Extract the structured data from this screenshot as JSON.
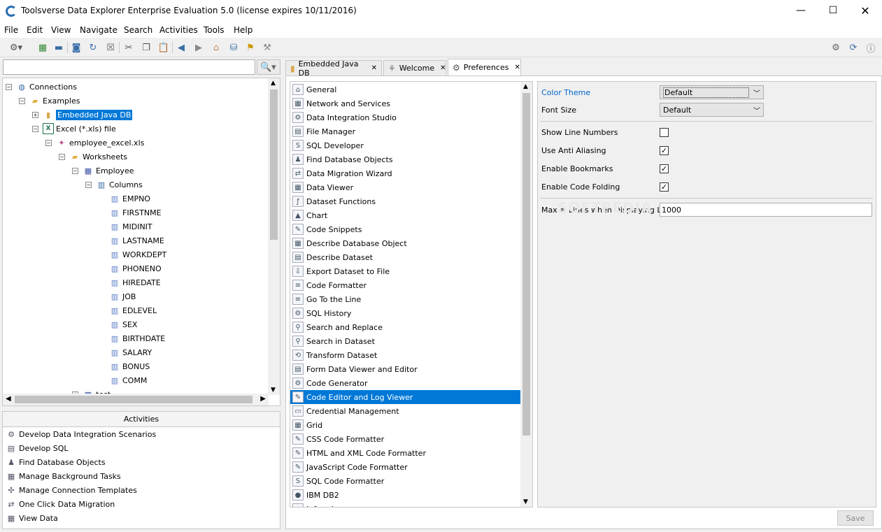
{
  "window": {
    "title": "Toolsverse Data Explorer Enterprise Evaluation 5.0 (license expires 10/11/2016)"
  },
  "menu": [
    "File",
    "Edit",
    "View",
    "Navigate",
    "Search",
    "Activities",
    "Tools",
    "Help"
  ],
  "tree": {
    "items": [
      {
        "label": "Connections",
        "depth": 0,
        "icon": "globe-icon",
        "expander": "−"
      },
      {
        "label": "Examples",
        "depth": 1,
        "icon": "folder-icon",
        "expander": "−"
      },
      {
        "label": "Embedded Java DB",
        "depth": 2,
        "icon": "database-icon",
        "expander": "+",
        "selected": true
      },
      {
        "label": "Excel (*.xls) file",
        "depth": 2,
        "icon": "excel-icon",
        "expander": "−"
      },
      {
        "label": "employee_excel.xls",
        "depth": 3,
        "icon": "file-icon",
        "expander": "−"
      },
      {
        "label": "Worksheets",
        "depth": 4,
        "icon": "folder-icon",
        "expander": "−"
      },
      {
        "label": "Employee",
        "depth": 5,
        "icon": "table-icon",
        "expander": "−"
      },
      {
        "label": "Columns",
        "depth": 6,
        "icon": "columns-icon",
        "expander": "−"
      },
      {
        "label": "EMPNO",
        "depth": 7,
        "icon": "column-icon"
      },
      {
        "label": "FIRSTNME",
        "depth": 7,
        "icon": "column-icon"
      },
      {
        "label": "MIDINIT",
        "depth": 7,
        "icon": "column-icon"
      },
      {
        "label": "LASTNAME",
        "depth": 7,
        "icon": "column-icon"
      },
      {
        "label": "WORKDEPT",
        "depth": 7,
        "icon": "column-icon"
      },
      {
        "label": "PHONENO",
        "depth": 7,
        "icon": "column-icon"
      },
      {
        "label": "HIREDATE",
        "depth": 7,
        "icon": "column-icon"
      },
      {
        "label": "JOB",
        "depth": 7,
        "icon": "column-icon"
      },
      {
        "label": "EDLEVEL",
        "depth": 7,
        "icon": "column-icon"
      },
      {
        "label": "SEX",
        "depth": 7,
        "icon": "column-icon"
      },
      {
        "label": "BIRTHDATE",
        "depth": 7,
        "icon": "column-icon"
      },
      {
        "label": "SALARY",
        "depth": 7,
        "icon": "column-icon"
      },
      {
        "label": "BONUS",
        "depth": 7,
        "icon": "column-icon"
      },
      {
        "label": "COMM",
        "depth": 7,
        "icon": "column-icon"
      },
      {
        "label": "test",
        "depth": 5,
        "icon": "table-icon",
        "expander": "+"
      }
    ]
  },
  "activities": {
    "header": "Activities",
    "items": [
      "Develop Data Integration Scenarios",
      "Develop SQL",
      "Find Database Objects",
      "Manage Background Tasks",
      "Manage Connection Templates",
      "One Click Data Migration",
      "View Data"
    ]
  },
  "tabs": [
    {
      "label": "Embedded Java DB",
      "icon": "database-icon"
    },
    {
      "label": "Welcome",
      "icon": "welcome-icon"
    },
    {
      "label": "Preferences",
      "icon": "gear-icon",
      "active": true
    }
  ],
  "preferences": {
    "items": [
      "General",
      "Network and Services",
      "Data Integration Studio",
      "File Manager",
      "SQL Developer",
      "Find Database Objects",
      "Data Migration Wizard",
      "Data Viewer",
      "Dataset Functions",
      "Chart",
      "Code Snippets",
      "Describe Database Object",
      "Describe Dataset",
      "Export Dataset to File",
      "Code Formatter",
      "Go To the Line",
      "SQL History",
      "Search and Replace",
      "Search in Dataset",
      "Transform Dataset",
      "Form Data Viewer and Editor",
      "Code Generator",
      "Code Editor and Log Viewer",
      "Credential Management",
      "Grid",
      "CSS Code Formatter",
      "HTML and XML Code Formatter",
      "JavaScript Code Formatter",
      "SQL Code Formatter",
      "IBM DB2",
      "Informix"
    ],
    "active_index": 22
  },
  "settings": {
    "color_theme_label": "Color Theme",
    "color_theme_value": "Default",
    "font_size_label": "Font Size",
    "font_size_value": "Default",
    "show_line_numbers_label": "Show Line Numbers",
    "show_line_numbers": false,
    "anti_aliasing_label": "Use Anti Aliasing",
    "anti_aliasing": true,
    "bookmarks_label": "Enable Bookmarks",
    "bookmarks": true,
    "code_folding_label": "Enable Code Folding",
    "code_folding": true,
    "max_lines_label": "Max # Lines when Displaying Log",
    "max_lines_value": "1000",
    "save_label": "Save",
    "check_glyph": "✓"
  },
  "watermark": "SOFTPEDIA",
  "colors": {
    "selection": "#0078d7",
    "accent_label": "#0066cc"
  }
}
